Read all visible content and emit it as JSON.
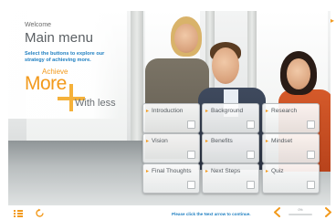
{
  "header": {
    "welcome": "Welcome",
    "title": "Main menu",
    "instructions": "Select the buttons to explore our strategy of achieving more."
  },
  "logo": {
    "achieve": "Achieve",
    "more": "More",
    "with_less": "With less"
  },
  "menu": {
    "items": [
      {
        "label": "Introduction"
      },
      {
        "label": "Background"
      },
      {
        "label": "Research"
      },
      {
        "label": "Vision"
      },
      {
        "label": "Benefits"
      },
      {
        "label": "Mindset"
      },
      {
        "label": "Final Thoughts"
      },
      {
        "label": "Next Steps"
      },
      {
        "label": "Quiz"
      }
    ]
  },
  "footer": {
    "hint": "Please click the Next arrow to continue.",
    "progress_text": "0%",
    "progress_fraction": 0.0,
    "icons": [
      "menu-icon",
      "refresh-icon",
      "prev-arrow-icon",
      "next-arrow-icon"
    ]
  },
  "colors": {
    "accent": "#f29a1d",
    "link_blue": "#1f7fc1",
    "title_gray": "#5a5f63"
  }
}
